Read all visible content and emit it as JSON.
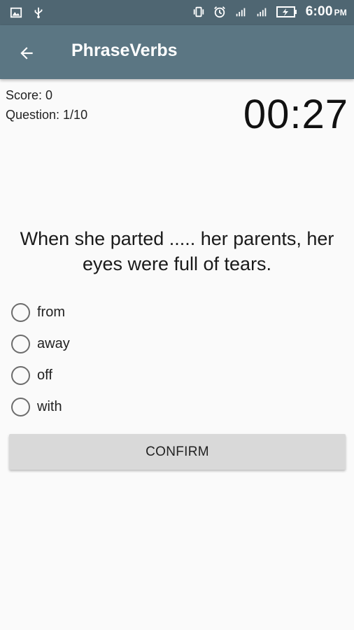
{
  "status_bar": {
    "time": "6:00",
    "ampm": "PM",
    "icons": [
      "gallery-icon",
      "usb-icon",
      "vibrate-icon",
      "alarm-icon",
      "signal-icon",
      "signal-icon",
      "battery-charging-icon"
    ]
  },
  "app_bar": {
    "title": "PhraseVerbs",
    "back_icon": "arrow-back-icon",
    "color": "#5b7683"
  },
  "quiz": {
    "score_label": "Score: 0",
    "question_label": "Question: 1/10",
    "timer": "00:27",
    "question_text": "When she parted ..... her parents, her eyes were full of tears.",
    "options": [
      "from",
      "away",
      "off",
      "with"
    ],
    "confirm_label": "CONFIRM"
  }
}
